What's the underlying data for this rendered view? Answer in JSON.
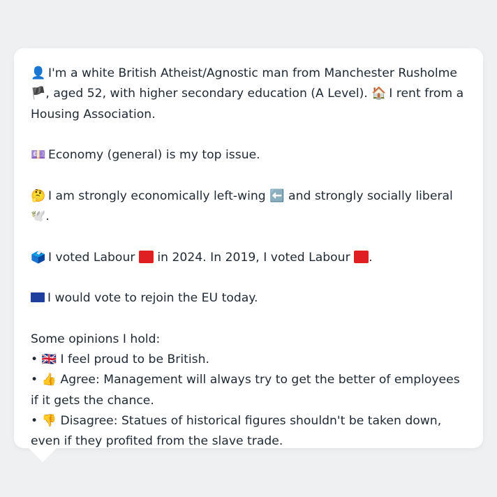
{
  "persona": {
    "intro": {
      "icon": "👤",
      "text_a": "I'm a white British Atheist/Agnostic man from Manchester Rusholme",
      "flag": "🏴",
      "text_b": ", aged 52, with higher secondary education (A Level).",
      "home_icon": "🏠",
      "text_c": "I rent from a Housing Association."
    },
    "top_issue": {
      "icon": "💷",
      "text": "Economy (general) is my top issue."
    },
    "politics": {
      "icon": "🤔",
      "text_a": "I am strongly economically left-wing",
      "left_icon": "⬅️",
      "text_b": "and strongly socially liberal",
      "dove_icon": "🕊️",
      "text_c": "."
    },
    "votes": {
      "icon": "🗳️",
      "text_a": "I voted Labour",
      "text_b": "in 2024. In 2019, I voted Labour",
      "text_c": ".",
      "party_color": "#e02020"
    },
    "eu": {
      "text": "I would vote to rejoin the EU today."
    },
    "opinions_heading": "Some opinions I hold:",
    "opinions": [
      {
        "bullet": "•",
        "icon": "🇬🇧",
        "text": "I feel proud to be British."
      },
      {
        "bullet": "•",
        "icon": "👍",
        "text": "Agree: Management will always try to get the better of employees if it gets the chance."
      },
      {
        "bullet": "•",
        "icon": "👎",
        "text": "Disagree: Statues of historical figures shouldn't be taken down, even if they profited from the slave trade."
      }
    ]
  }
}
